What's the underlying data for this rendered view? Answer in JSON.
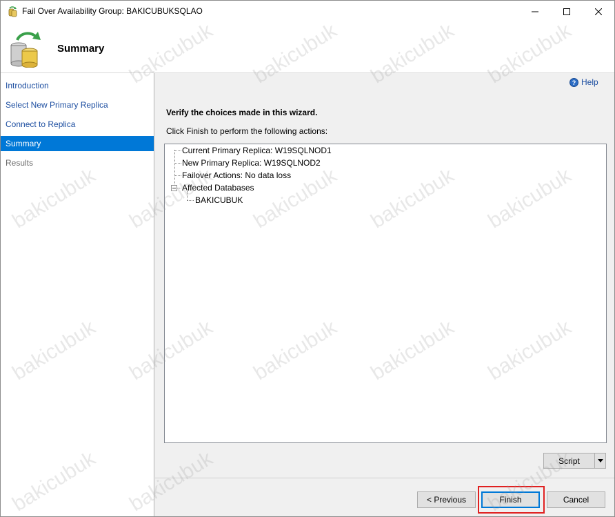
{
  "window": {
    "title": "Fail Over Availability Group: BAKICUBUKSQLAO",
    "icon": "wizard-app-icon"
  },
  "banner": {
    "title": "Summary",
    "icon": "database-failover-icon"
  },
  "nav": {
    "items": [
      {
        "label": "Introduction",
        "state": "link"
      },
      {
        "label": "Select New Primary Replica",
        "state": "link"
      },
      {
        "label": "Connect to Replica",
        "state": "link"
      },
      {
        "label": "Summary",
        "state": "active"
      },
      {
        "label": "Results",
        "state": "disabled"
      }
    ]
  },
  "main": {
    "help_label": "Help",
    "heading": "Verify the choices made in this wizard.",
    "subheading": "Click Finish to perform the following actions:",
    "tree": [
      {
        "label": "Current Primary Replica: W19SQLNOD1",
        "level": 0
      },
      {
        "label": "New Primary Replica: W19SQLNOD2",
        "level": 0
      },
      {
        "label": "Failover Actions: No data loss",
        "level": 0
      },
      {
        "label": "Affected Databases",
        "level": 0,
        "expanded": true
      },
      {
        "label": "BAKICUBUK",
        "level": 1
      }
    ],
    "script_label": "Script"
  },
  "buttons": {
    "previous": "< Previous",
    "finish": "Finish",
    "cancel": "Cancel"
  },
  "watermark": "bakicubuk",
  "colors": {
    "accent": "#0078d7",
    "link": "#1e4fa1",
    "highlight": "#e02020"
  }
}
